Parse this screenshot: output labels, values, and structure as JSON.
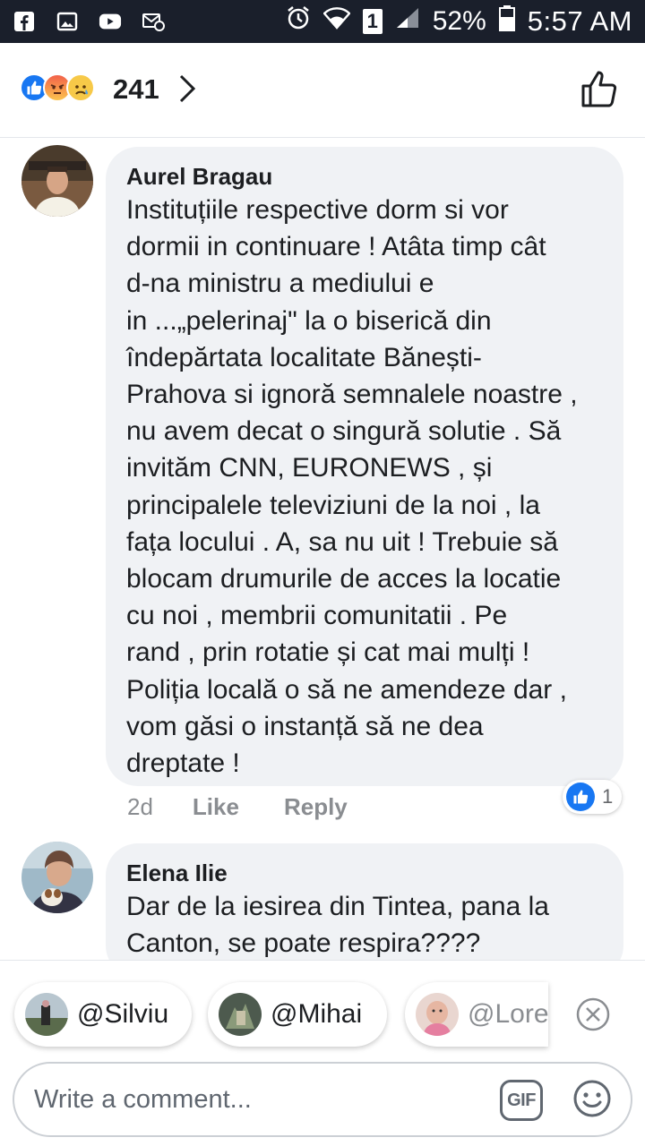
{
  "status_bar": {
    "battery": "52%",
    "time": "5:57 AM",
    "sim_slot": "1"
  },
  "reactions": {
    "count": "241",
    "icons": [
      "like-icon",
      "angry-icon",
      "sad-icon"
    ]
  },
  "comments": [
    {
      "author": "Aurel Bragau",
      "text": "Instituțiile respective dorm si vor\ndormii in continuare ! Atâta timp cât\nd-na ministru a mediului e\nin ...„pelerinaj\" la o biserică din\nîndepărtata localitate Bănești-\nPrahova si ignoră semnalele noastre ,\nnu avem decat o singură solutie . Să\ninvităm CNN, EURONEWS , și\nprincipalele televiziuni de la noi , la\nfața locului . A, sa nu uit ! Trebuie să\nblocam drumurile de acces la locatie\ncu noi , membrii comunitatii . Pe\nrand , prin rotatie și cat mai mulți !\nPoliția locală o să ne amendeze dar ,\nvom găsi o instanță să ne dea\ndreptate !",
      "time": "2d",
      "like_label": "Like",
      "reply_label": "Reply",
      "like_count": "1"
    },
    {
      "author": "Elena Ilie",
      "text": "Dar de la iesirea din Tintea, pana la\nCanton, se poate respira????"
    }
  ],
  "mentions": [
    {
      "label": "@Silviu"
    },
    {
      "label": "@Mihai"
    },
    {
      "label": "@Lore"
    }
  ],
  "compose": {
    "placeholder": "Write a comment...",
    "gif_label": "GIF"
  },
  "colors": {
    "accent": "#1877f2",
    "bubble": "#f0f2f5",
    "status_bar": "#1a1f2b"
  }
}
